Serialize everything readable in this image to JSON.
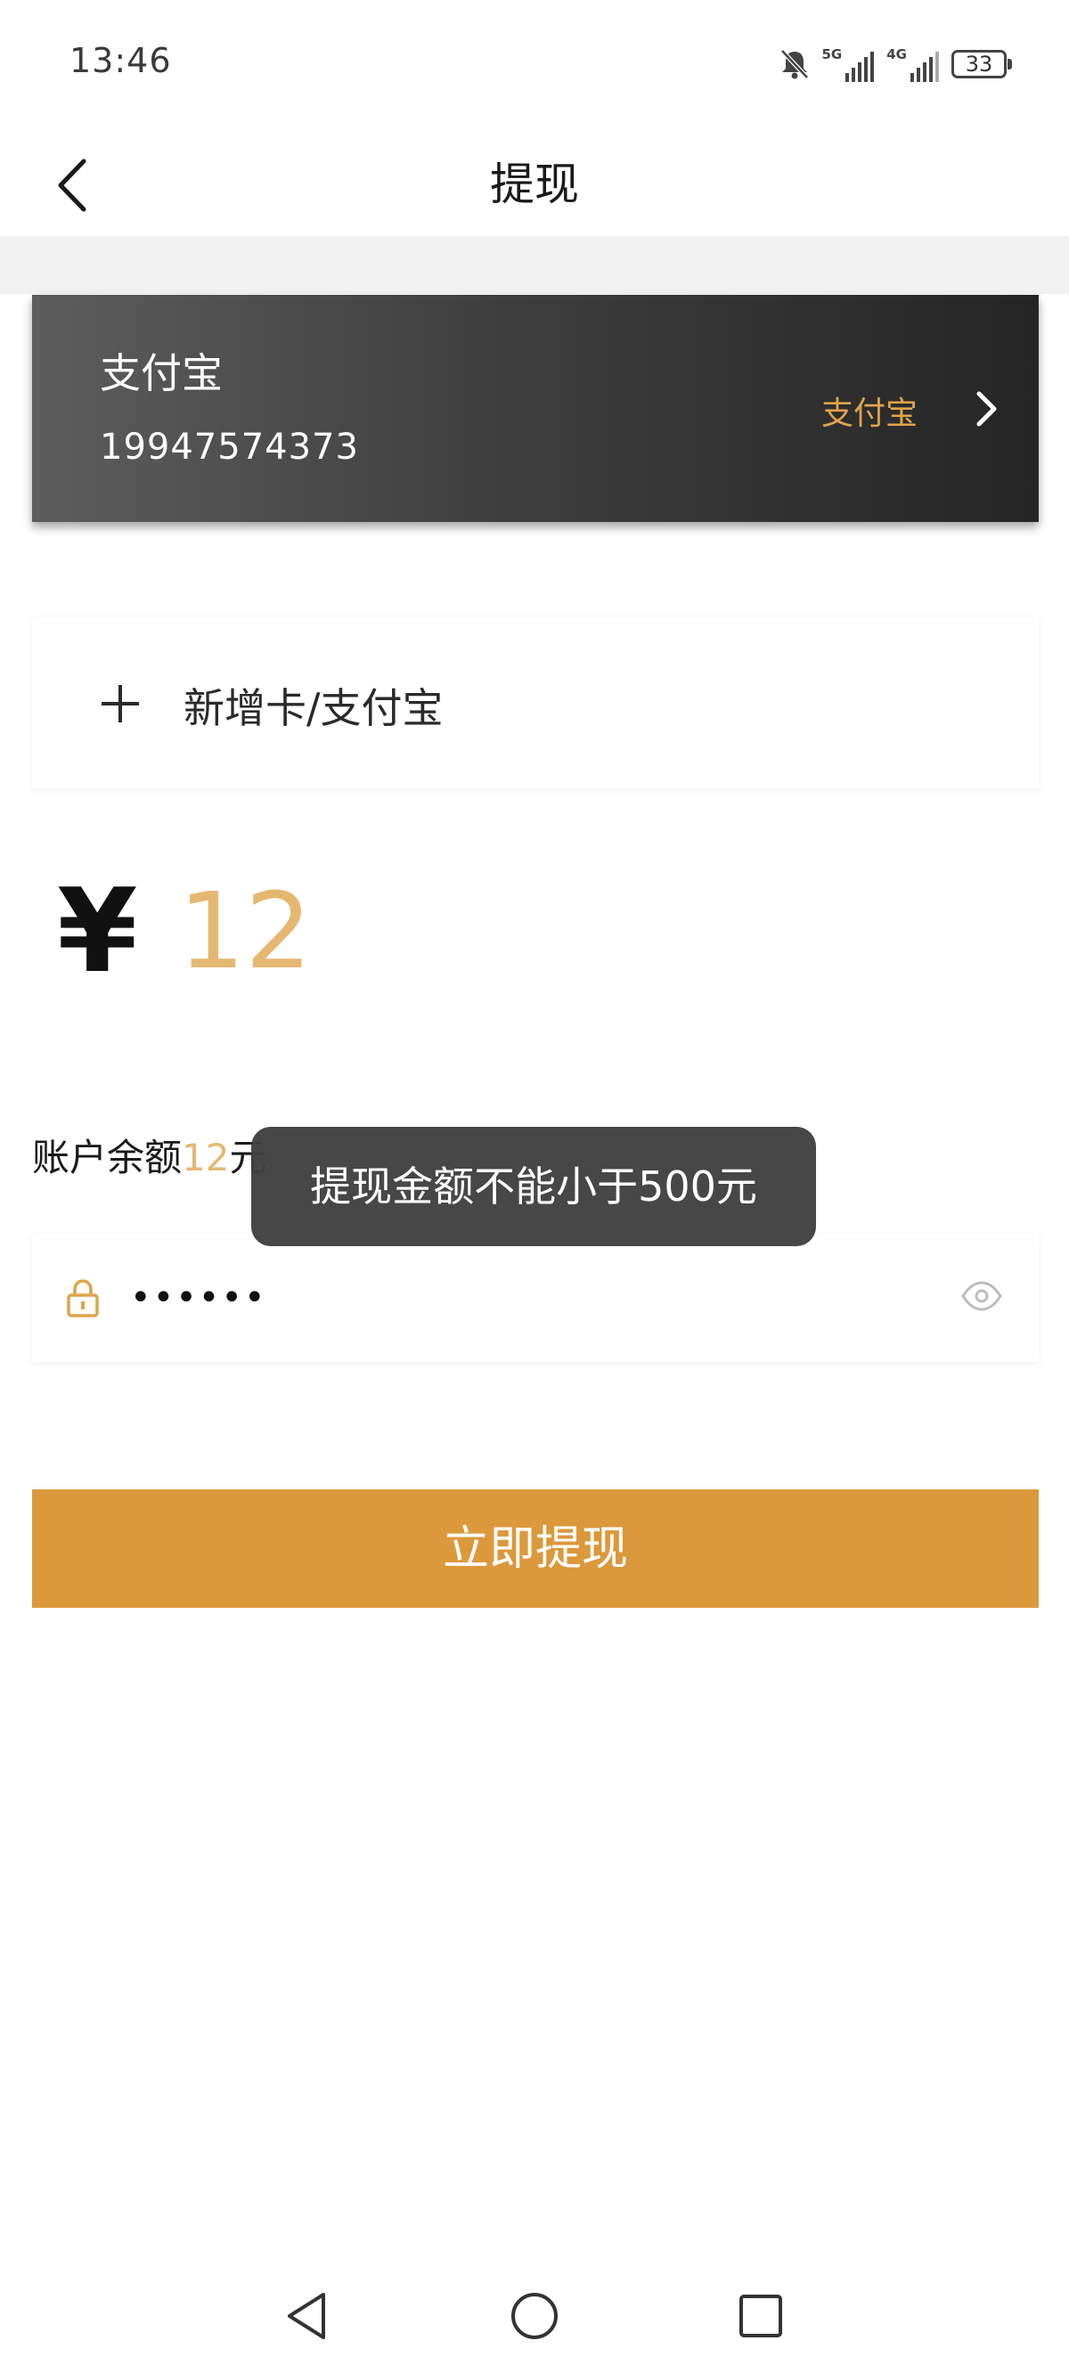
{
  "status_bar": {
    "time": "13:46",
    "net1": "5G",
    "net2": "4G",
    "battery": "33"
  },
  "header": {
    "title": "提现"
  },
  "account_card": {
    "name": "支付宝",
    "number": "19947574373",
    "type_label": "支付宝"
  },
  "add_card": {
    "label": "新增卡/支付宝"
  },
  "amount": {
    "currency": "¥",
    "value": "12"
  },
  "balance": {
    "prefix": "账户余额",
    "value": "12",
    "suffix": "元"
  },
  "password": {
    "value": "••••••"
  },
  "toast": {
    "message": "提现金额不能小于500元"
  },
  "submit": {
    "label": "立即提现"
  },
  "colors": {
    "accent": "#db993b",
    "amount": "#e5b872",
    "card_dark": "#252525"
  }
}
